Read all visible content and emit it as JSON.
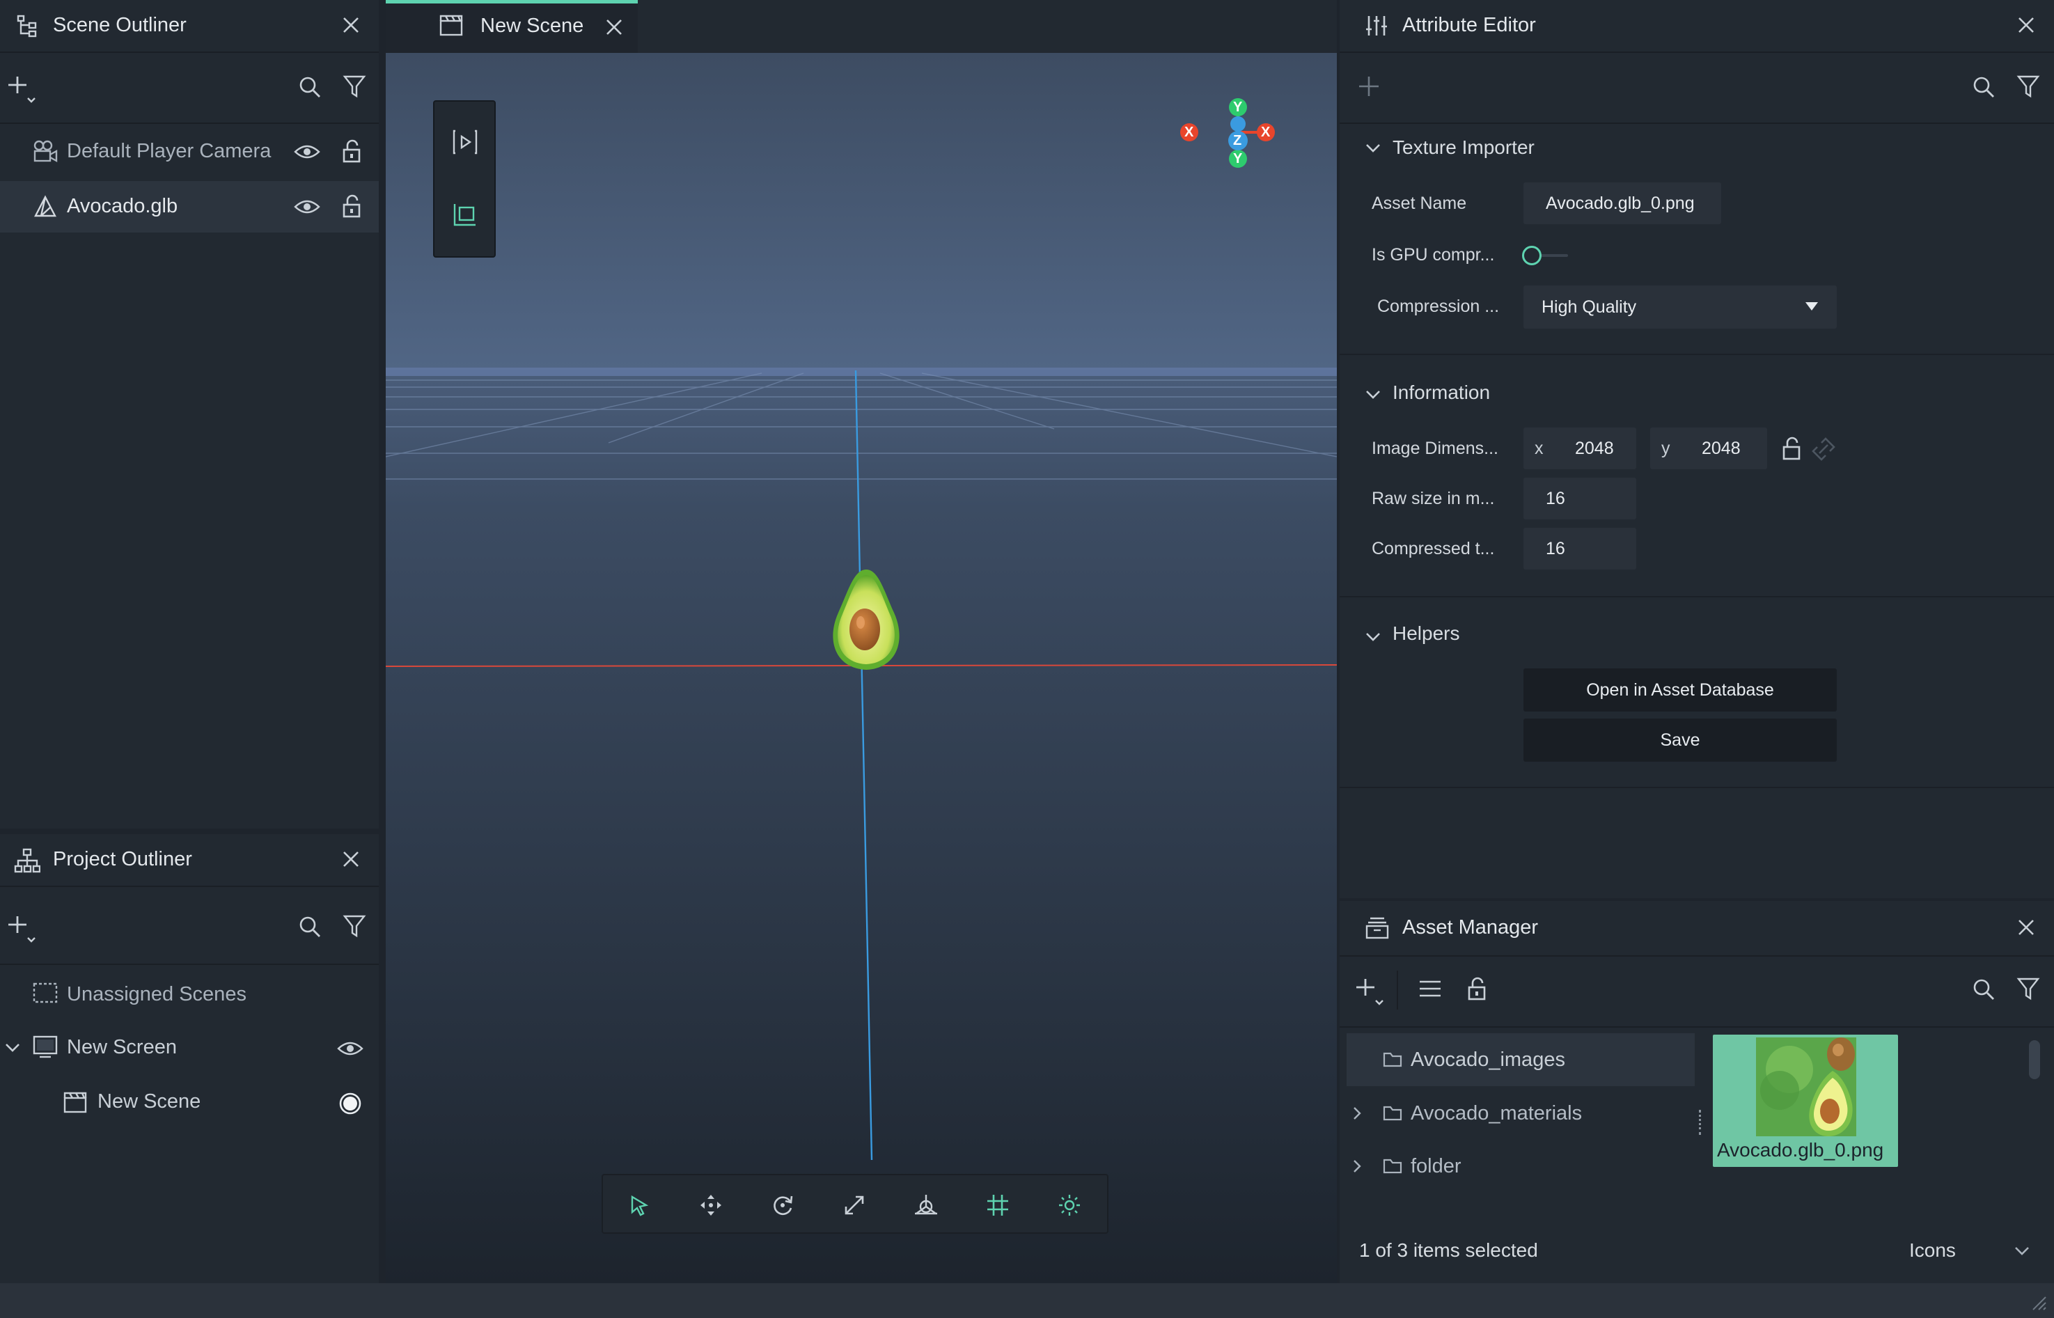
{
  "scene_outliner": {
    "title": "Scene Outliner",
    "items": [
      {
        "label": "Default Player Camera"
      },
      {
        "label": "Avocado.glb"
      }
    ]
  },
  "project_outliner": {
    "title": "Project Outliner",
    "items": [
      {
        "label": "Unassigned Scenes"
      },
      {
        "label": "New Screen"
      },
      {
        "label": "New Scene"
      }
    ]
  },
  "viewport": {
    "tab_label": "New Scene",
    "gizmo": {
      "y": "Y",
      "x": "X",
      "z": "Z"
    }
  },
  "attribute_editor": {
    "title": "Attribute Editor",
    "texture_importer": {
      "title": "Texture Importer",
      "asset_name_label": "Asset Name",
      "asset_name_value": "Avocado.glb_0.png",
      "gpu_label": "Is GPU compr...",
      "gpu_enabled": false,
      "compression_label": "Compression ...",
      "compression_value": "High Quality"
    },
    "information": {
      "title": "Information",
      "dim_label": "Image Dimens...",
      "x_label": "x",
      "x_value": "2048",
      "y_label": "y",
      "y_value": "2048",
      "raw_label": "Raw size in m...",
      "raw_value": "16",
      "compressed_label": "Compressed t...",
      "compressed_value": "16"
    },
    "helpers": {
      "title": "Helpers",
      "open_button": "Open in Asset Database",
      "save_button": "Save"
    }
  },
  "asset_manager": {
    "title": "Asset Manager",
    "folders": [
      {
        "label": "Avocado_images"
      },
      {
        "label": "Avocado_materials"
      },
      {
        "label": "folder"
      }
    ],
    "thumbnail_label": "Avocado.glb_0.png",
    "status": "1 of 3 items selected",
    "view_mode": "Icons"
  },
  "colors": {
    "accent": "#5ed3b0",
    "axis_x": "#e8452c",
    "axis_y": "#2ecb6e",
    "axis_z": "#3a9be0",
    "selected_thumb": "#6fc6a4"
  }
}
